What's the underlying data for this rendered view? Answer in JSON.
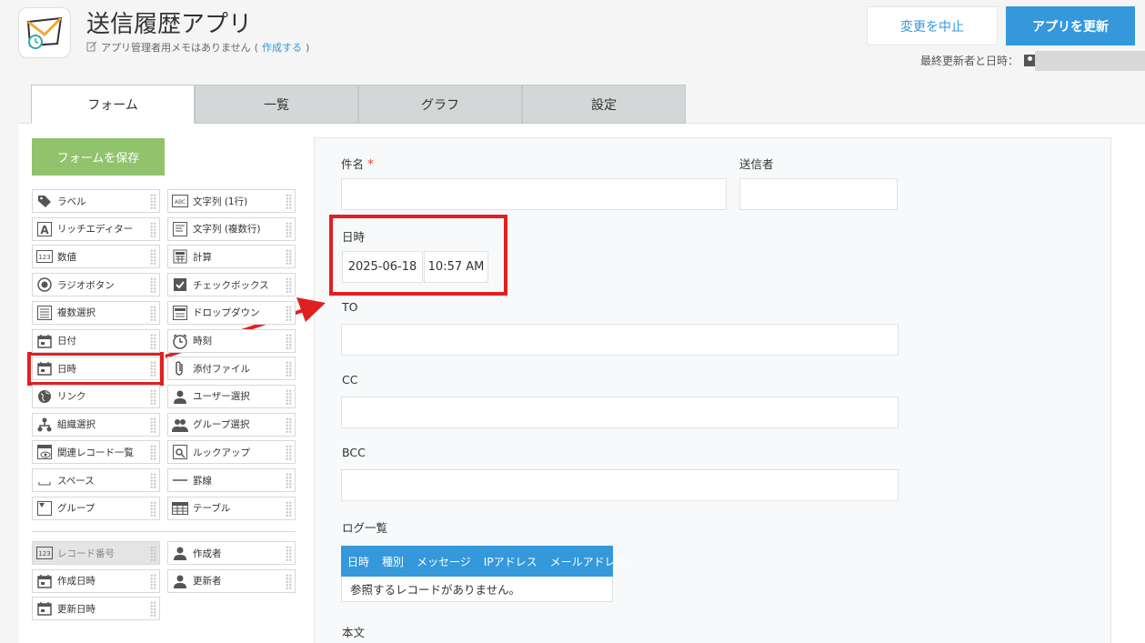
{
  "header": {
    "title": "送信履歴アプリ",
    "memo_text": "アプリ管理者用メモはありません",
    "memo_link": "作成する",
    "cancel_label": "変更を中止",
    "update_label": "アプリを更新",
    "last_updated_label": "最終更新者と日時："
  },
  "tabs": [
    {
      "label": "フォーム",
      "active": true
    },
    {
      "label": "一覧"
    },
    {
      "label": "グラフ"
    },
    {
      "label": "設定"
    }
  ],
  "palette": {
    "save_label": "フォームを保存",
    "items": [
      {
        "label": "ラベル",
        "icon": "tag-icon"
      },
      {
        "label": "文字列 (1行)",
        "icon": "abc-icon"
      },
      {
        "label": "リッチエディター",
        "icon": "letter-a-icon"
      },
      {
        "label": "文字列 (複数行)",
        "icon": "multiline-text-icon"
      },
      {
        "label": "数値",
        "icon": "number-icon"
      },
      {
        "label": "計算",
        "icon": "calculator-icon"
      },
      {
        "label": "ラジオボタン",
        "icon": "radio-icon"
      },
      {
        "label": "チェックボックス",
        "icon": "checkbox-icon"
      },
      {
        "label": "複数選択",
        "icon": "multi-select-icon"
      },
      {
        "label": "ドロップダウン",
        "icon": "dropdown-icon"
      },
      {
        "label": "日付",
        "icon": "calendar-icon"
      },
      {
        "label": "時刻",
        "icon": "clock-icon"
      },
      {
        "label": "日時",
        "icon": "calendar-icon"
      },
      {
        "label": "添付ファイル",
        "icon": "paperclip-icon"
      },
      {
        "label": "リンク",
        "icon": "globe-icon"
      },
      {
        "label": "ユーザー選択",
        "icon": "user-icon"
      },
      {
        "label": "組織選択",
        "icon": "org-icon"
      },
      {
        "label": "グループ選択",
        "icon": "group-icon"
      },
      {
        "label": "関連レコード一覧",
        "icon": "related-records-icon"
      },
      {
        "label": "ルックアップ",
        "icon": "lookup-icon"
      },
      {
        "label": "スペース",
        "icon": "space-icon"
      },
      {
        "label": "罫線",
        "icon": "line-icon"
      },
      {
        "label": "グループ",
        "icon": "group-field-icon"
      },
      {
        "label": "テーブル",
        "icon": "table-icon"
      }
    ],
    "system_items": [
      {
        "label": "レコード番号",
        "icon": "number-icon",
        "disabled": true
      },
      {
        "label": "作成者",
        "icon": "user-icon"
      },
      {
        "label": "作成日時",
        "icon": "calendar-icon"
      },
      {
        "label": "更新者",
        "icon": "user-icon"
      },
      {
        "label": "更新日時",
        "icon": "calendar-icon"
      }
    ]
  },
  "form": {
    "subject_label": "件名",
    "required_mark": "*",
    "sender_label": "送信者",
    "datetime_label": "日時",
    "date_value": "2025-06-18",
    "time_value": "10:57 AM",
    "to_label": "TO",
    "cc_label": "CC",
    "bcc_label": "BCC",
    "log_label": "ログ一覧",
    "log_columns": [
      "日時",
      "種別",
      "メッセージ",
      "IPアドレス",
      "メールアドレス"
    ],
    "log_empty": "参照するレコードがありません。",
    "body_label": "本文"
  },
  "colors": {
    "accent": "#3498db",
    "save": "#91c36c",
    "highlight": "#e02020"
  }
}
